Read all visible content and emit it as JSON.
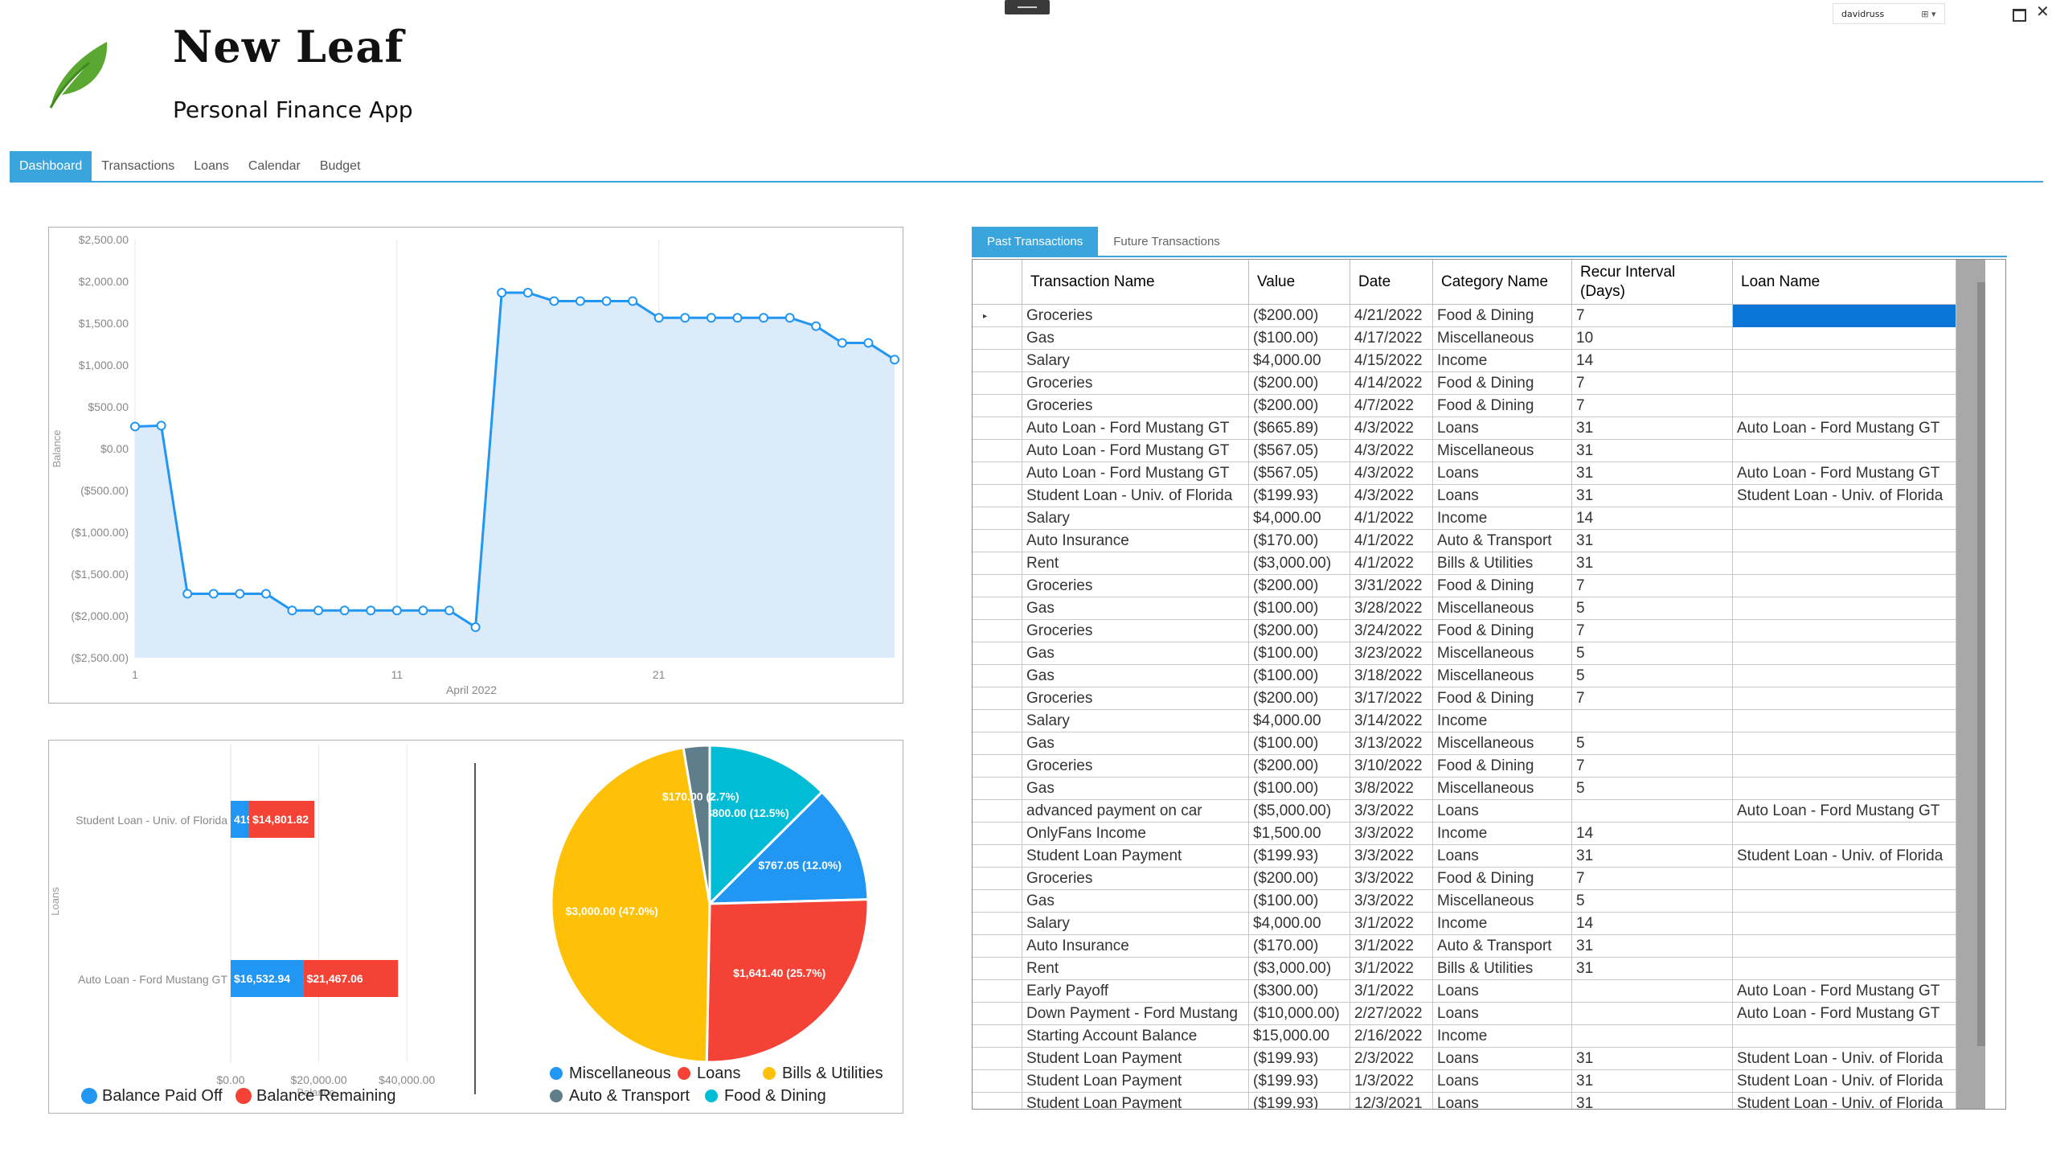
{
  "app": {
    "title": "New Leaf",
    "subtitle": "Personal Finance App",
    "user": "davidruss"
  },
  "tabs": [
    "Dashboard",
    "Transactions",
    "Loans",
    "Calendar",
    "Budget"
  ],
  "active_tab": "Dashboard",
  "transaction_tabs": [
    "Past Transactions",
    "Future Transactions"
  ],
  "colors": {
    "accent": "#3aa5dc",
    "selection": "#0a75d6",
    "paid": "#2196f3",
    "remaining": "#f44336",
    "bills": "#ffc107",
    "auto": "#607d8b",
    "food": "#00bcd4"
  },
  "chart_data": [
    {
      "type": "area",
      "title": "",
      "xlabel": "April 2022",
      "ylabel": "Balance",
      "x_ticks": [
        "1",
        "11",
        "21"
      ],
      "y_ticks": [
        "$2,500.00",
        "$2,000.00",
        "$1,500.00",
        "$1,000.00",
        "$500.00",
        "$0.00",
        "($500.00)",
        "($1,000.00)",
        "($1,500.00)",
        "($2,000.00)",
        "($2,500.00)"
      ],
      "ylim": [
        -2500,
        2500
      ],
      "xlim": [
        1,
        30
      ],
      "x": [
        1,
        2,
        3,
        4,
        5,
        6,
        7,
        8,
        9,
        10,
        11,
        12,
        13,
        14,
        15,
        16,
        17,
        18,
        19,
        20,
        21,
        22,
        23,
        24,
        25,
        26,
        27,
        28,
        29,
        30
      ],
      "values": [
        265,
        275,
        -1735,
        -1735,
        -1735,
        -1735,
        -1935,
        -1935,
        -1935,
        -1935,
        -1935,
        -1935,
        -1935,
        -2135,
        1865,
        1865,
        1765,
        1765,
        1765,
        1765,
        1565,
        1565,
        1565,
        1565,
        1565,
        1565,
        1465,
        1265,
        1265,
        1065
      ],
      "grid": "vertical"
    },
    {
      "type": "bar",
      "orientation": "horizontal",
      "stacked": true,
      "ylabel": "Loans",
      "xlabel": "Balance",
      "categories": [
        "Student Loan - Univ. of Florida",
        "Auto Loan - Ford Mustang GT"
      ],
      "series": [
        {
          "name": "Balance Paid Off",
          "values": [
            4198.31,
            16532.94
          ],
          "labels": [
            "4198.31",
            "$16,532.94"
          ]
        },
        {
          "name": "Balance Remaining",
          "values": [
            14801.82,
            21467.06
          ],
          "labels": [
            "$14,801.82",
            "$21,467.06"
          ]
        }
      ],
      "x_ticks": [
        "$0.00",
        "$20,000.00",
        "$40,000.00"
      ],
      "xlim": [
        0,
        50000
      ],
      "legend": "bottom"
    },
    {
      "type": "pie",
      "labels": [
        "Miscellaneous",
        "Loans",
        "Bills & Utilities",
        "Auto & Transport",
        "Food & Dining"
      ],
      "values": [
        767.05,
        1641.4,
        3000.0,
        170.0,
        800.0
      ],
      "percent": [
        12.0,
        25.7,
        47.0,
        2.7,
        12.5
      ],
      "slice_labels": [
        "$767.05 (12.0%)",
        "$1,641.40 (25.7%)",
        "$3,000.00 (47.0%)",
        "$170.00 (2.7%)",
        "$800.00 (12.5%)"
      ],
      "legend": "bottom"
    }
  ],
  "table": {
    "columns": [
      "Transaction Name",
      "Value",
      "Date",
      "Category Name",
      "Recur Interval\n(Days)",
      "Loan Name"
    ],
    "rows": [
      [
        "Groceries",
        "($200.00)",
        "4/21/2022",
        "Food & Dining",
        "7",
        ""
      ],
      [
        "Gas",
        "($100.00)",
        "4/17/2022",
        "Miscellaneous",
        "10",
        ""
      ],
      [
        "Salary",
        "$4,000.00",
        "4/15/2022",
        "Income",
        "14",
        ""
      ],
      [
        "Groceries",
        "($200.00)",
        "4/14/2022",
        "Food & Dining",
        "7",
        ""
      ],
      [
        "Groceries",
        "($200.00)",
        "4/7/2022",
        "Food & Dining",
        "7",
        ""
      ],
      [
        "Auto Loan - Ford Mustang GT",
        "($665.89)",
        "4/3/2022",
        "Loans",
        "31",
        "Auto Loan - Ford Mustang GT"
      ],
      [
        "Auto Loan - Ford Mustang GT",
        "($567.05)",
        "4/3/2022",
        "Miscellaneous",
        "31",
        ""
      ],
      [
        "Auto Loan - Ford Mustang GT",
        "($567.05)",
        "4/3/2022",
        "Loans",
        "31",
        "Auto Loan - Ford Mustang GT"
      ],
      [
        "Student Loan - Univ. of Florida",
        "($199.93)",
        "4/3/2022",
        "Loans",
        "31",
        "Student Loan - Univ. of Florida"
      ],
      [
        "Salary",
        "$4,000.00",
        "4/1/2022",
        "Income",
        "14",
        ""
      ],
      [
        "Auto Insurance",
        "($170.00)",
        "4/1/2022",
        "Auto & Transport",
        "31",
        ""
      ],
      [
        "Rent",
        "($3,000.00)",
        "4/1/2022",
        "Bills & Utilities",
        "31",
        ""
      ],
      [
        "Groceries",
        "($200.00)",
        "3/31/2022",
        "Food & Dining",
        "7",
        ""
      ],
      [
        "Gas",
        "($100.00)",
        "3/28/2022",
        "Miscellaneous",
        "5",
        ""
      ],
      [
        "Groceries",
        "($200.00)",
        "3/24/2022",
        "Food & Dining",
        "7",
        ""
      ],
      [
        "Gas",
        "($100.00)",
        "3/23/2022",
        "Miscellaneous",
        "5",
        ""
      ],
      [
        "Gas",
        "($100.00)",
        "3/18/2022",
        "Miscellaneous",
        "5",
        ""
      ],
      [
        "Groceries",
        "($200.00)",
        "3/17/2022",
        "Food & Dining",
        "7",
        ""
      ],
      [
        "Salary",
        "$4,000.00",
        "3/14/2022",
        "Income",
        "",
        ""
      ],
      [
        "Gas",
        "($100.00)",
        "3/13/2022",
        "Miscellaneous",
        "5",
        ""
      ],
      [
        "Groceries",
        "($200.00)",
        "3/10/2022",
        "Food & Dining",
        "7",
        ""
      ],
      [
        "Gas",
        "($100.00)",
        "3/8/2022",
        "Miscellaneous",
        "5",
        ""
      ],
      [
        "advanced payment on car",
        "($5,000.00)",
        "3/3/2022",
        "Loans",
        "",
        "Auto Loan - Ford Mustang GT"
      ],
      [
        "OnlyFans Income",
        "$1,500.00",
        "3/3/2022",
        "Income",
        "14",
        ""
      ],
      [
        "Student Loan Payment",
        "($199.93)",
        "3/3/2022",
        "Loans",
        "31",
        "Student Loan - Univ. of Florida"
      ],
      [
        "Groceries",
        "($200.00)",
        "3/3/2022",
        "Food & Dining",
        "7",
        ""
      ],
      [
        "Gas",
        "($100.00)",
        "3/3/2022",
        "Miscellaneous",
        "5",
        ""
      ],
      [
        "Salary",
        "$4,000.00",
        "3/1/2022",
        "Income",
        "14",
        ""
      ],
      [
        "Auto Insurance",
        "($170.00)",
        "3/1/2022",
        "Auto & Transport",
        "31",
        ""
      ],
      [
        "Rent",
        "($3,000.00)",
        "3/1/2022",
        "Bills & Utilities",
        "31",
        ""
      ],
      [
        "Early Payoff",
        "($300.00)",
        "3/1/2022",
        "Loans",
        "",
        "Auto Loan - Ford Mustang GT"
      ],
      [
        "Down Payment - Ford Mustang",
        "($10,000.00)",
        "2/27/2022",
        "Loans",
        "",
        "Auto Loan - Ford Mustang GT"
      ],
      [
        "Starting Account Balance",
        "$15,000.00",
        "2/16/2022",
        "Income",
        "",
        ""
      ],
      [
        "Student Loan Payment",
        "($199.93)",
        "2/3/2022",
        "Loans",
        "31",
        "Student Loan - Univ. of Florida"
      ],
      [
        "Student Loan Payment",
        "($199.93)",
        "1/3/2022",
        "Loans",
        "31",
        "Student Loan - Univ. of Florida"
      ],
      [
        "Student Loan Payment",
        "($199.93)",
        "12/3/2021",
        "Loans",
        "31",
        "Student Loan - Univ. of Florida"
      ]
    ]
  }
}
